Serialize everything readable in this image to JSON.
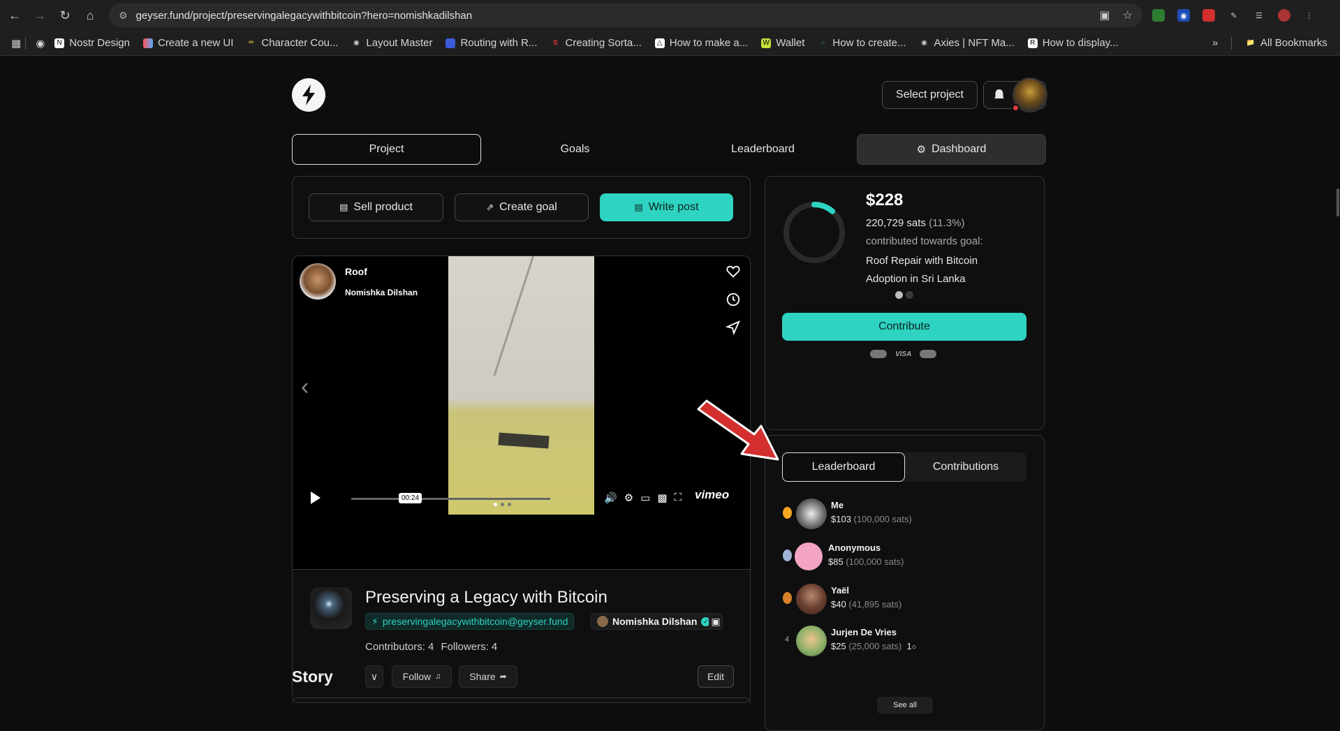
{
  "browser": {
    "url": "geyser.fund/project/preservingalegacywithbitcoin?hero=nomishkadilshan",
    "bookmarks": [
      {
        "label": "Nostr Design"
      },
      {
        "label": "Create a new UI"
      },
      {
        "label": "Character Cou..."
      },
      {
        "label": "Layout Master"
      },
      {
        "label": "Routing with R..."
      },
      {
        "label": "Creating Sorta..."
      },
      {
        "label": "How to make a..."
      },
      {
        "label": "Wallet"
      },
      {
        "label": "How to create..."
      },
      {
        "label": "Axies | NFT Ma..."
      },
      {
        "label": "How to display..."
      }
    ],
    "all_bookmarks": "All Bookmarks"
  },
  "header": {
    "select_project": "Select project"
  },
  "tabs": {
    "project": "Project",
    "goals": "Goals",
    "leaderboard": "Leaderboard",
    "dashboard": "Dashboard"
  },
  "actions": {
    "sell_product": "Sell product",
    "create_goal": "Create goal",
    "write_post": "Write post"
  },
  "video": {
    "title": "Roof",
    "author": "Nomishka Dilshan",
    "time": "00:24",
    "brand": "vimeo"
  },
  "project": {
    "title": "Preserving a Legacy with Bitcoin",
    "lightning_address": "preservingalegacywithbitcoin@geyser.fund",
    "owner": "Nomishka Dilshan",
    "contributors": "Contributors: 4",
    "followers": "Followers: 4",
    "follow": "Follow",
    "share": "Share",
    "edit": "Edit"
  },
  "story_heading": "Story",
  "goal": {
    "amount": "$228",
    "sats": "220,729 sats",
    "percent_label": "(11.3%)",
    "percent": 11.3,
    "contributed_label": "contributed towards goal:",
    "name": "Roof Repair with Bitcoin Adoption in Sri Lanka",
    "contribute": "Contribute",
    "visa": "VISA"
  },
  "leaderboard": {
    "tab_leaderboard": "Leaderboard",
    "tab_contributions": "Contributions",
    "rows": [
      {
        "rank": "1",
        "name": "Me",
        "amount": "$103",
        "sats": "(100,000 sats)",
        "extra": ""
      },
      {
        "rank": "2",
        "name": "Anonymous",
        "amount": "$85",
        "sats": "(100,000 sats)",
        "extra": ""
      },
      {
        "rank": "3",
        "name": "Yaël",
        "amount": "$40",
        "sats": "(41,895 sats)",
        "extra": ""
      },
      {
        "rank": "4",
        "name": "Jurjen De Vries",
        "amount": "$25",
        "sats": "(25,000 sats)",
        "extra": "1"
      }
    ],
    "see_all": "See all"
  },
  "colors": {
    "accent": "#2ed3c1",
    "annotation_arrow": "#d32f2f"
  }
}
